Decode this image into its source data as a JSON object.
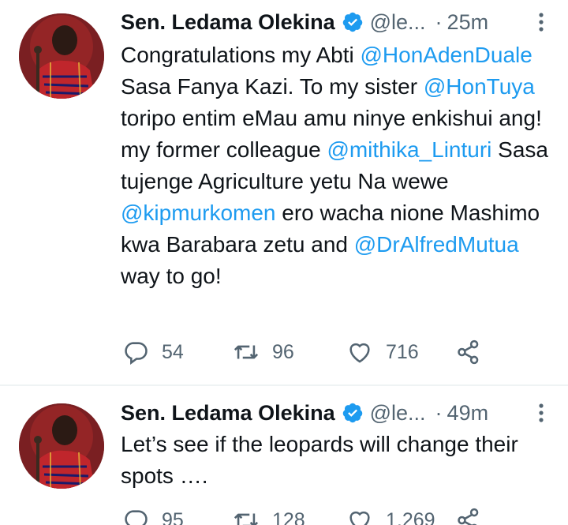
{
  "tweets": [
    {
      "author_name": "Sen. Ledama Olekina",
      "handle": "@le...",
      "separator": "·",
      "time": "25m",
      "text_parts": [
        {
          "t": "Congratulations my Abti ",
          "m": false
        },
        {
          "t": "@HonAdenDuale",
          "m": true
        },
        {
          "t": " Sasa Fanya Kazi. To my sister ",
          "m": false
        },
        {
          "t": "@HonTuya",
          "m": true
        },
        {
          "t": " toripo entim eMau amu ninye enkishui ang! my former colleague ",
          "m": false
        },
        {
          "t": "@mithika_Linturi",
          "m": true
        },
        {
          "t": " Sasa tujenge Agriculture yetu Na wewe ",
          "m": false
        },
        {
          "t": "@kipmurkomen",
          "m": true
        },
        {
          "t": " ero wacha nione Mashimo kwa Barabara zetu and ",
          "m": false
        },
        {
          "t": "@DrAlfredMutua",
          "m": true
        },
        {
          "t": " way to go!",
          "m": false
        }
      ],
      "replies": "54",
      "retweets": "96",
      "likes": "716"
    },
    {
      "author_name": "Sen. Ledama Olekina",
      "handle": "@le...",
      "separator": "·",
      "time": "49m",
      "text_parts": [
        {
          "t": "Let’s see if the leopards will change their spots ….",
          "m": false
        }
      ],
      "replies": "95",
      "retweets": "128",
      "likes": "1,269"
    }
  ],
  "colors": {
    "accent": "#1d9bf0",
    "text": "#0f1419",
    "secondary": "#536471",
    "divider": "#eff3f4"
  },
  "icons": [
    "verified-badge-icon",
    "more-icon",
    "reply-icon",
    "retweet-icon",
    "like-icon",
    "share-icon"
  ]
}
